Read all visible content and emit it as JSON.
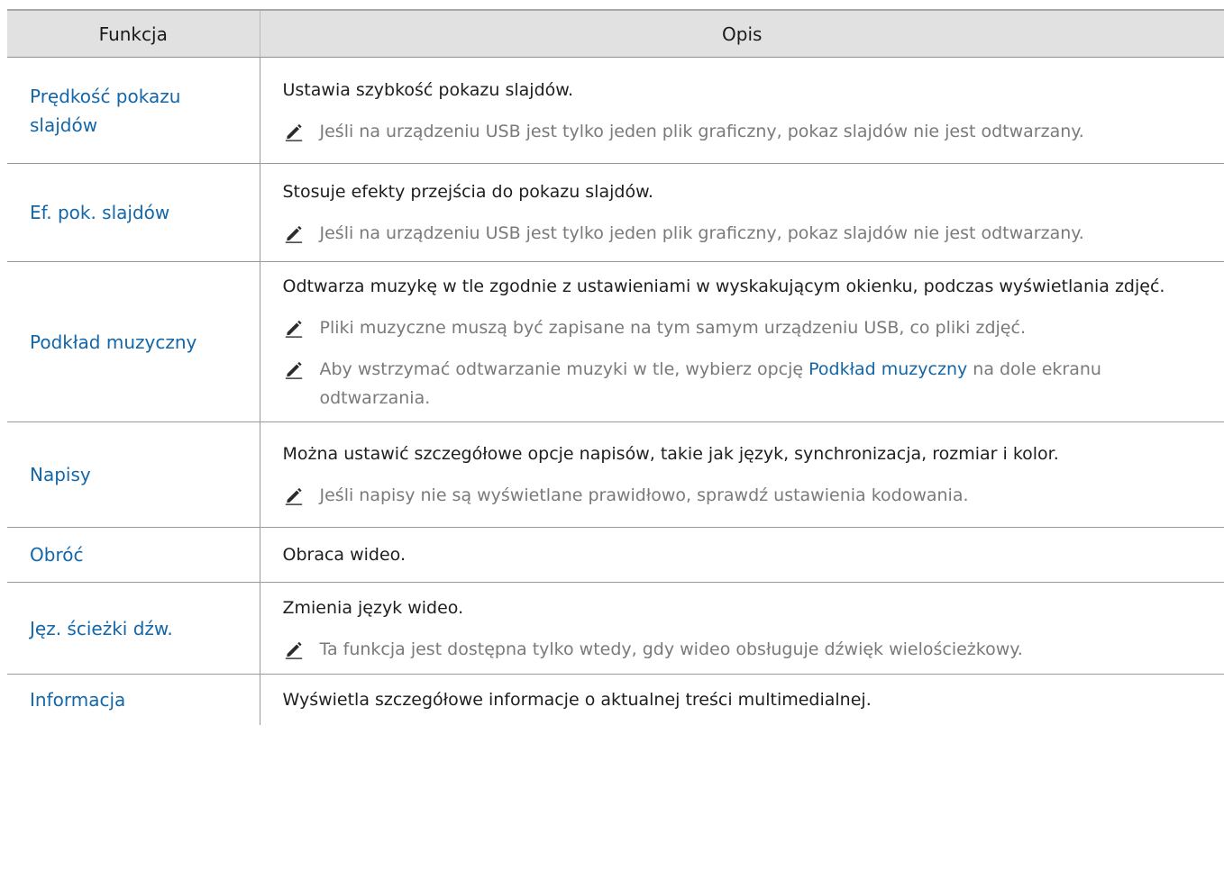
{
  "table": {
    "headers": {
      "function": "Funkcja",
      "description": "Opis"
    },
    "rows": [
      {
        "name": "Prędkość pokazu slajdów",
        "description": "Ustawia szybkość pokazu slajdów.",
        "notes": [
          {
            "text": "Jeśli na urządzeniu USB jest tylko jeden plik graficzny, pokaz slajdów nie jest odtwarzany."
          }
        ]
      },
      {
        "name": "Ef. pok. slajdów",
        "description": "Stosuje efekty przejścia do pokazu slajdów.",
        "notes": [
          {
            "text": "Jeśli na urządzeniu USB jest tylko jeden plik graficzny, pokaz slajdów nie jest odtwarzany."
          }
        ]
      },
      {
        "name": "Podkład muzyczny",
        "description": "Odtwarza muzykę w tle zgodnie z ustawieniami w wyskakującym okienku, podczas wyświetlania zdjęć.",
        "notes": [
          {
            "text": "Pliki muzyczne muszą być zapisane na tym samym urządzeniu USB, co pliki zdjęć."
          },
          {
            "before": "Aby wstrzymać odtwarzanie muzyki w tle, wybierz opcję ",
            "highlight": "Podkład muzyczny",
            "after": " na dole ekranu odtwarzania."
          }
        ]
      },
      {
        "name": "Napisy",
        "description": "Można ustawić szczegółowe opcje napisów, takie jak język, synchronizacja, rozmiar i kolor.",
        "notes": [
          {
            "text": "Jeśli napisy nie są wyświetlane prawidłowo, sprawdź ustawienia kodowania."
          }
        ]
      },
      {
        "name": "Obróć",
        "description": "Obraca wideo.",
        "notes": []
      },
      {
        "name": "Jęz. ścieżki dźw.",
        "description": "Zmienia język wideo.",
        "notes": [
          {
            "text": "Ta funkcja jest dostępna tylko wtedy, gdy wideo obsługuje dźwięk wielościeżkowy."
          }
        ]
      },
      {
        "name": "Informacja",
        "description": "Wyświetla szczegółowe informacje o aktualnej treści multimedialnej.",
        "notes": []
      }
    ]
  },
  "colors": {
    "function_link": "#1366a8",
    "note_text": "#7a7a7a",
    "header_background": "#e1e1e1"
  },
  "icons": {
    "note": "pencil-note-icon"
  }
}
